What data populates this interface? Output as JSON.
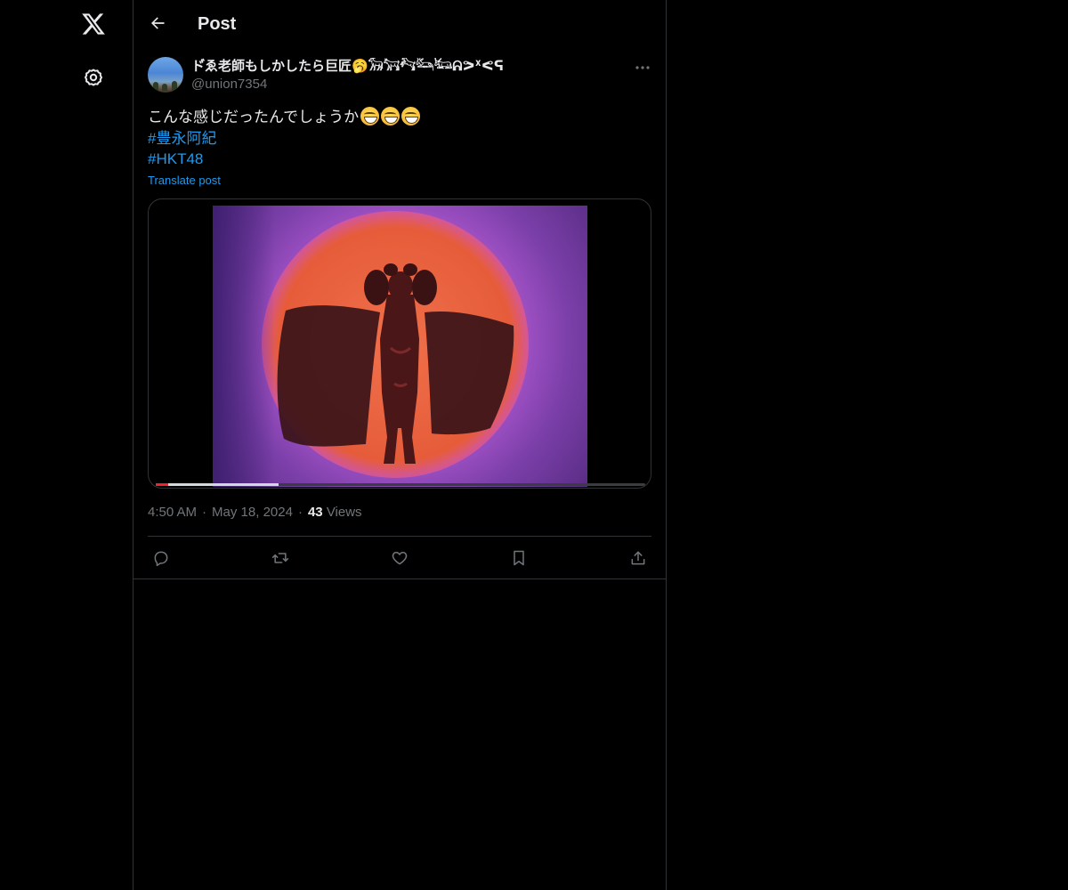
{
  "header": {
    "title": "Post"
  },
  "post": {
    "author": {
      "display_name": "ド゙ゑ老師もしかしたら巨匠🥱𓃘𓃙𓃚𓃛𓃜ᕱᕗᕽᕙᕋ",
      "handle": "@union7354"
    },
    "text": {
      "line1": "こんな感じだったんでしょうか",
      "emoji_count": 3,
      "hashtags": [
        "#豊永阿紀",
        "#HKT48"
      ]
    },
    "translate_label": "Translate post",
    "media": {
      "progress_buffered": 0.25,
      "progress_played": 0.025
    },
    "meta": {
      "time": "4:50 AM",
      "date": "May 18, 2024",
      "views_count": "43",
      "views_label": "Views"
    }
  },
  "colors": {
    "background": "#000000",
    "text": "#e7e9ea",
    "secondary": "#71767b",
    "accent": "#1d9bf0",
    "border": "#2f3336"
  },
  "icons": {
    "logo": "x-logo-icon",
    "settings": "gear-icon",
    "back": "arrow-left-icon",
    "more": "more-horizontal-icon",
    "reply": "reply-icon",
    "repost": "repost-icon",
    "like": "heart-icon",
    "bookmark": "bookmark-icon",
    "share": "share-icon"
  }
}
